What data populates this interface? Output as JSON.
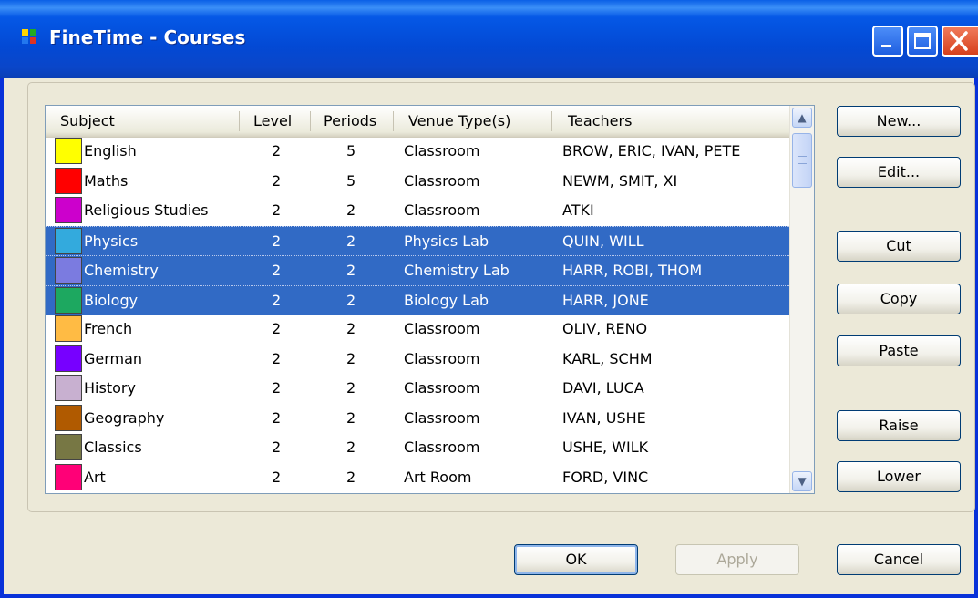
{
  "window": {
    "title": "FineTime - Courses",
    "controls": [
      "minimize-icon",
      "maximize-icon",
      "close-icon"
    ]
  },
  "list": {
    "columns": [
      "Subject",
      "Level",
      "Periods",
      "Venue Type(s)",
      "Teachers"
    ],
    "rows": [
      {
        "subject": "English",
        "level": "2",
        "periods": "5",
        "venue": "Classroom",
        "teachers": "BROW, ERIC, IVAN, PETE",
        "color": "#ffff00",
        "selected": false
      },
      {
        "subject": "Maths",
        "level": "2",
        "periods": "5",
        "venue": "Classroom",
        "teachers": "NEWM, SMIT, XI",
        "color": "#ff0000",
        "selected": false
      },
      {
        "subject": "Religious Studies",
        "level": "2",
        "periods": "2",
        "venue": "Classroom",
        "teachers": "ATKI",
        "color": "#cc00cc",
        "selected": false
      },
      {
        "subject": "Physics",
        "level": "2",
        "periods": "2",
        "venue": "Physics Lab",
        "teachers": "QUIN, WILL",
        "color": "#33aadd",
        "selected": true
      },
      {
        "subject": "Chemistry",
        "level": "2",
        "periods": "2",
        "venue": "Chemistry Lab",
        "teachers": "HARR, ROBI, THOM",
        "color": "#7b7be0",
        "selected": true
      },
      {
        "subject": "Biology",
        "level": "2",
        "periods": "2",
        "venue": "Biology Lab",
        "teachers": "HARR, JONE",
        "color": "#1da860",
        "selected": true
      },
      {
        "subject": "French",
        "level": "2",
        "periods": "2",
        "venue": "Classroom",
        "teachers": "OLIV, RENO",
        "color": "#ffbb44",
        "selected": false
      },
      {
        "subject": "German",
        "level": "2",
        "periods": "2",
        "venue": "Classroom",
        "teachers": "KARL, SCHM",
        "color": "#7700ff",
        "selected": false
      },
      {
        "subject": "History",
        "level": "2",
        "periods": "2",
        "venue": "Classroom",
        "teachers": "DAVI, LUCA",
        "color": "#c8b0d0",
        "selected": false
      },
      {
        "subject": "Geography",
        "level": "2",
        "periods": "2",
        "venue": "Classroom",
        "teachers": "IVAN, USHE",
        "color": "#b05a00",
        "selected": false
      },
      {
        "subject": "Classics",
        "level": "2",
        "periods": "2",
        "venue": "Classroom",
        "teachers": "USHE, WILK",
        "color": "#777744",
        "selected": false
      },
      {
        "subject": "Art",
        "level": "2",
        "periods": "2",
        "venue": "Art Room",
        "teachers": "FORD, VINC",
        "color": "#ff0077",
        "selected": false
      },
      {
        "subject": "",
        "level": "",
        "periods": "",
        "venue": "",
        "teachers": "",
        "color": "#ff88ee",
        "selected": false
      }
    ]
  },
  "side_buttons": {
    "new": "New...",
    "edit": "Edit...",
    "cut": "Cut",
    "copy": "Copy",
    "paste": "Paste",
    "raise": "Raise",
    "lower": "Lower"
  },
  "footer_buttons": {
    "ok": "OK",
    "apply": "Apply",
    "cancel": "Cancel"
  }
}
